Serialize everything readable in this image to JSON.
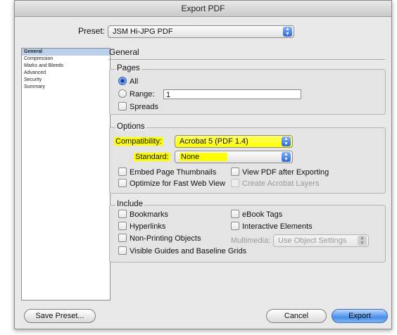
{
  "window": {
    "title": "Export PDF"
  },
  "preset": {
    "label": "Preset:",
    "value": "JSM Hi-JPG PDF"
  },
  "sidebar": {
    "items": [
      {
        "label": "General",
        "selected": true
      },
      {
        "label": "Compression",
        "selected": false
      },
      {
        "label": "Marks and Bleeds",
        "selected": false
      },
      {
        "label": "Advanced",
        "selected": false
      },
      {
        "label": "Security",
        "selected": false
      },
      {
        "label": "Summary",
        "selected": false
      }
    ]
  },
  "section": {
    "title": "General"
  },
  "pages": {
    "title": "Pages",
    "all_label": "All",
    "range_label": "Range:",
    "range_value": "1",
    "spreads_label": "Spreads",
    "selected": "All"
  },
  "options": {
    "title": "Options",
    "compatibility_label": "Compatibility:",
    "compatibility_value": "Acrobat 5 (PDF 1.4)",
    "standard_label": "Standard:",
    "standard_value": "None",
    "embed_thumbnails": "Embed Page Thumbnails",
    "view_after": "View PDF after Exporting",
    "optimize_web": "Optimize for Fast Web View",
    "create_layers": "Create Acrobat Layers",
    "highlight_color": "#ffff00"
  },
  "include": {
    "title": "Include",
    "bookmarks": "Bookmarks",
    "hyperlinks": "Hyperlinks",
    "non_printing": "Non-Printing Objects",
    "visible_guides": "Visible Guides and Baseline Grids",
    "ebook_tags": "eBook Tags",
    "interactive": "Interactive Elements",
    "multimedia_label": "Multimedia:",
    "multimedia_value": "Use Object Settings"
  },
  "buttons": {
    "save_preset": "Save Preset...",
    "cancel": "Cancel",
    "export": "Export",
    "accent": "#4a8ee8"
  }
}
